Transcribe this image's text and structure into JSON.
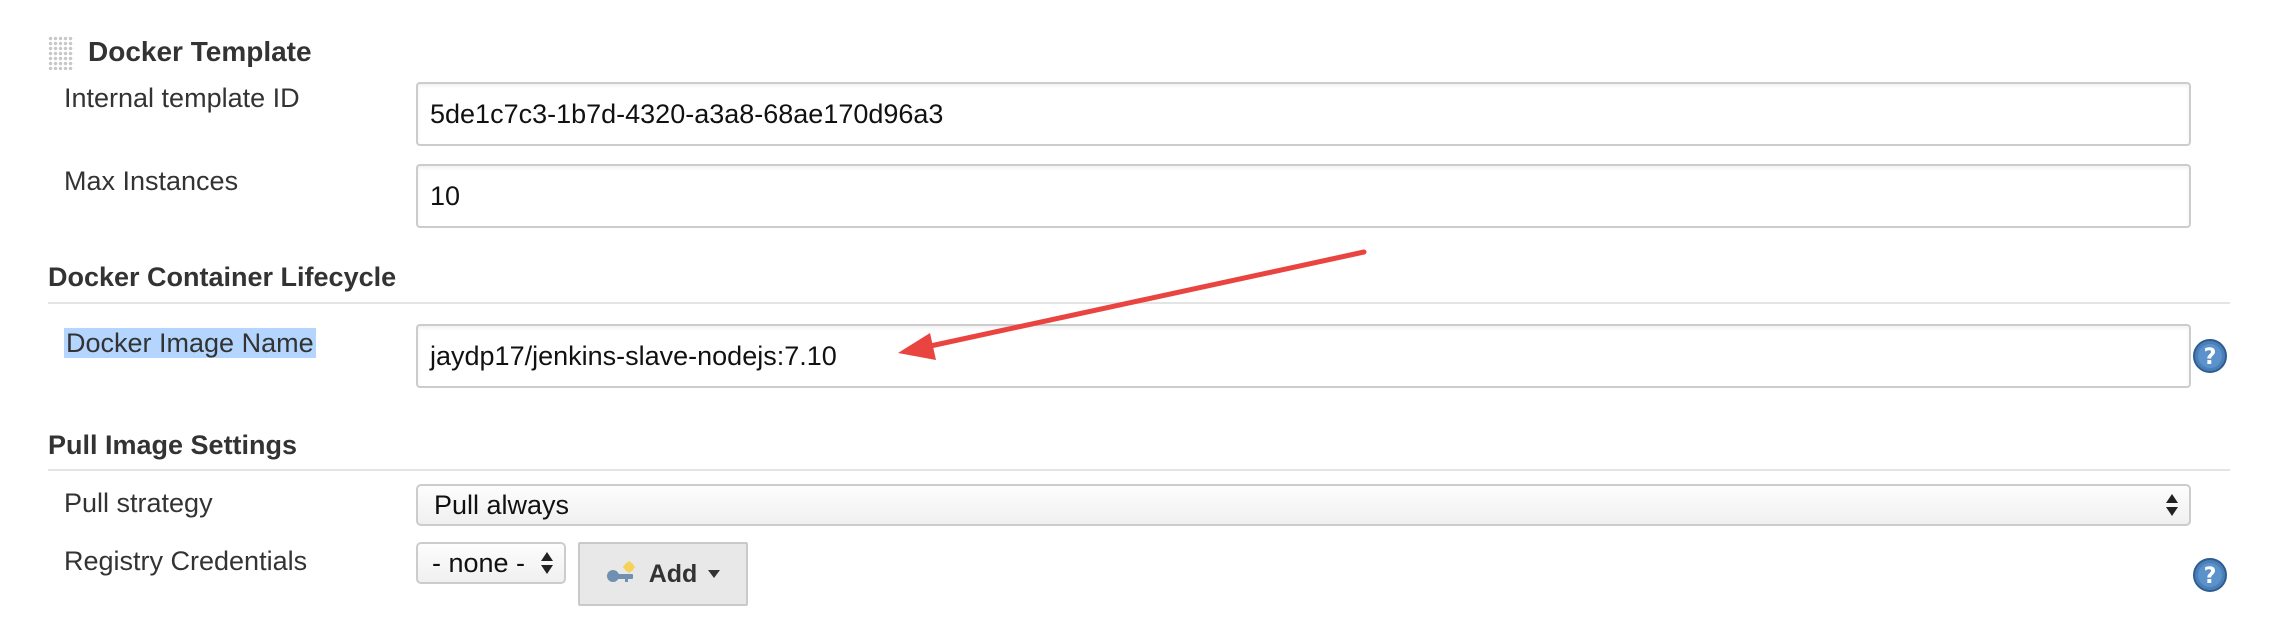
{
  "section": {
    "title": "Docker Template"
  },
  "fields": {
    "template_id": {
      "label": "Internal template ID",
      "value": "5de1c7c3-1b7d-4320-a3a8-68ae170d96a3"
    },
    "max_instances": {
      "label": "Max Instances",
      "value": "10"
    }
  },
  "lifecycle": {
    "title": "Docker Container Lifecycle",
    "image_name": {
      "label": "Docker Image Name",
      "value": "jaydp17/jenkins-slave-nodejs:7.10"
    }
  },
  "pull": {
    "title": "Pull Image Settings",
    "strategy": {
      "label": "Pull strategy",
      "selected": "Pull always"
    },
    "credentials": {
      "label": "Registry Credentials",
      "selected": "- none -",
      "add_label": "Add"
    }
  },
  "colors": {
    "arrow": "#e94440",
    "selection_highlight": "#b4d5fe",
    "help_icon": "#4a7fb8"
  },
  "icons": [
    "drag-handle-icon",
    "key-icon",
    "caret-down-icon",
    "help-icon"
  ]
}
